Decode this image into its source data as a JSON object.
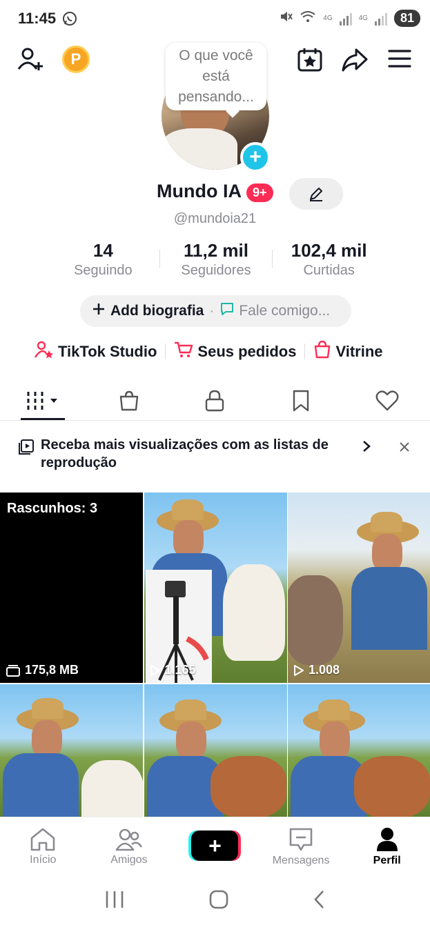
{
  "status_bar": {
    "time": "11:45",
    "battery": "81",
    "net1": "4G",
    "net2": "4G"
  },
  "top_bar": {
    "coin_letter": "P",
    "icons": [
      "add-user-icon",
      "coin-icon",
      "calendar-star-icon",
      "share-icon",
      "menu-icon"
    ]
  },
  "profile": {
    "thought_bubble": "O que você está pensando...",
    "name": "Mundo IA",
    "notifications_badge": "9+",
    "handle": "@mundoia21"
  },
  "stats": [
    {
      "value": "14",
      "label": "Seguindo"
    },
    {
      "value": "11,2 mil",
      "label": "Seguidores"
    },
    {
      "value": "102,4 mil",
      "label": "Curtidas"
    }
  ],
  "bio": {
    "add_label": "Add biografia",
    "separator": "·",
    "chat_label": "Fale comigo..."
  },
  "links": [
    {
      "label": "TikTok Studio"
    },
    {
      "label": "Seus pedidos"
    },
    {
      "label": "Vitrine"
    }
  ],
  "tabs": [
    "videos",
    "shop",
    "private",
    "saved",
    "liked"
  ],
  "banner": {
    "text": "Receba mais visualizações com as listas de reprodução"
  },
  "grid": {
    "drafts_label": "Rascunhos: 3",
    "drafts_size": "175,8 MB",
    "views": [
      "1.165",
      "1.008"
    ]
  },
  "bottom_nav": [
    {
      "label": "Início"
    },
    {
      "label": "Amigos"
    },
    {
      "label": ""
    },
    {
      "label": "Mensagens"
    },
    {
      "label": "Perfil"
    }
  ],
  "colors": {
    "accent_red": "#fe2c55",
    "accent_cyan": "#25f4ee",
    "add_badge": "#20c4e8"
  }
}
